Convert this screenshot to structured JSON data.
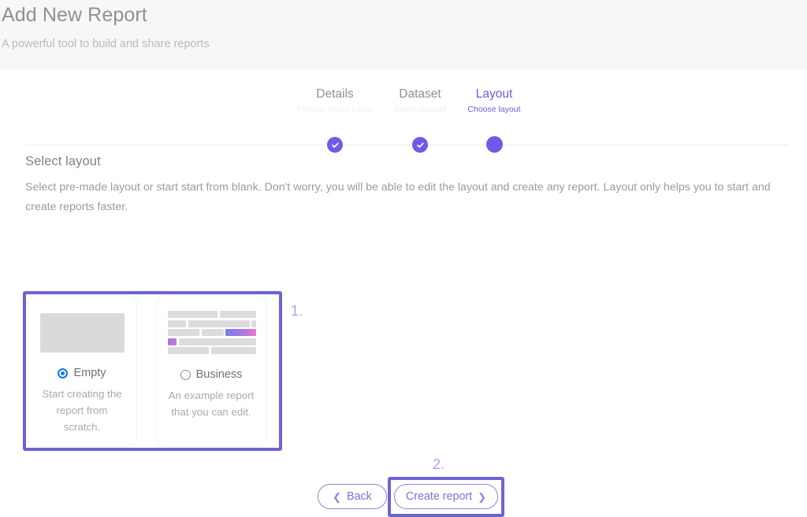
{
  "header": {
    "title": "Add New Report",
    "subtitle": "A powerful tool to build and share reports"
  },
  "stepper": {
    "steps": [
      {
        "title": "Details",
        "subtitle": "Provide report name",
        "state": "completed",
        "icon": "check-icon"
      },
      {
        "title": "Dataset",
        "subtitle": "Select dataset",
        "state": "completed",
        "icon": "check-icon"
      },
      {
        "title": "Layout",
        "subtitle": "Choose layout",
        "state": "active",
        "icon": "dot-icon"
      }
    ]
  },
  "main": {
    "section_title": "Select layout",
    "section_description": "Select pre-made layout or start start from blank. Don't worry, you will be able to edit the layout and create any report. Layout only helps you to start and create reports faster.",
    "cards": [
      {
        "label": "Empty",
        "description": "Start creating the report from scratch.",
        "selected": true,
        "thumbnail": "empty-thumbnail"
      },
      {
        "label": "Business",
        "description": "An example report that you can edit.",
        "selected": false,
        "thumbnail": "business-thumbnail"
      }
    ]
  },
  "annotations": {
    "marker_one": "1.",
    "marker_two": "2."
  },
  "footer": {
    "back_label": "Back",
    "back_icon": "chevron-left-icon",
    "create_label": "Create report",
    "create_icon": "chevron-right-icon"
  },
  "colors": {
    "accent_purple": "#6b5ce7",
    "annotation_purple": "#6c63d8",
    "radio_blue": "#1a73e8",
    "header_bg": "#f7f7f8"
  }
}
